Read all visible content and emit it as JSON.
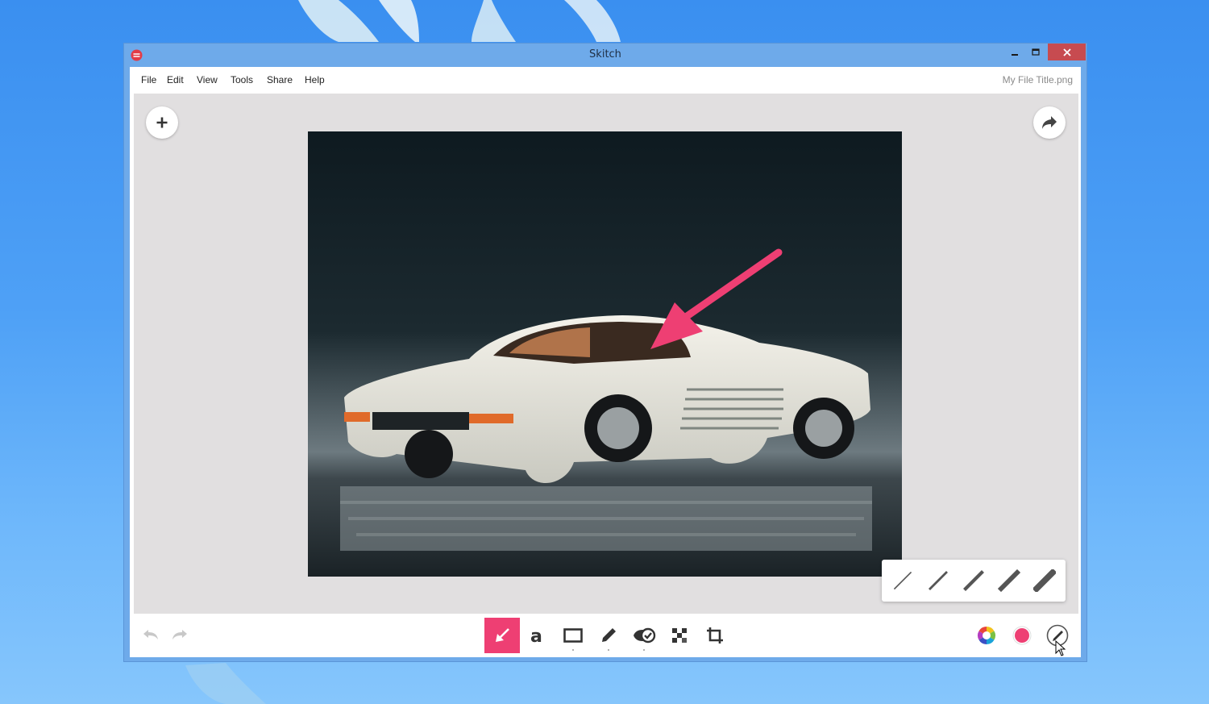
{
  "window": {
    "title": "Skitch",
    "file_title": "My File Title.png"
  },
  "menu": [
    "File",
    "Edit",
    "View",
    "Tools",
    "Share",
    "Help"
  ],
  "toolbar": {
    "active_tool": "arrow",
    "tools": [
      "arrow",
      "text",
      "rectangle",
      "pen",
      "stamp",
      "pixelate",
      "crop"
    ],
    "current_color": "#ee3f73",
    "accent_color": "#ee3f73"
  },
  "stroke_widths": 5,
  "icons": {
    "app": "skitch-icon",
    "add": "plus-icon",
    "share": "share-arrow-icon",
    "undo": "undo-icon",
    "redo": "redo-icon",
    "color_wheel": "color-wheel-icon",
    "stroke": "pen-stroke-icon"
  }
}
